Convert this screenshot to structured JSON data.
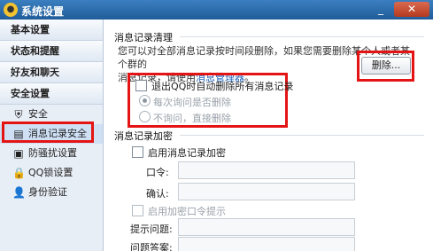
{
  "window": {
    "title": "系统设置",
    "minimize_glyph": "_",
    "close_glyph": "✕"
  },
  "sidebar": {
    "sections": [
      {
        "label": "基本设置"
      },
      {
        "label": "状态和提醒"
      },
      {
        "label": "好友和聊天"
      },
      {
        "label": "安全设置"
      }
    ],
    "items": [
      {
        "label": "安全",
        "icon": "shield-icon"
      },
      {
        "label": "消息记录安全",
        "icon": "message-record-icon"
      },
      {
        "label": "防骚扰设置",
        "icon": "anti-harass-icon"
      },
      {
        "label": "QQ锁设置",
        "icon": "lock-icon"
      },
      {
        "label": "身份验证",
        "icon": "person-icon"
      }
    ]
  },
  "main": {
    "cleanup": {
      "title": "消息记录清理",
      "desc_line1": "您可以对全部消息记录按时间段删除，如果您需要删除某个人或者某个群的",
      "desc_line2_prefix": "消息记录，请使用",
      "desc_link": "消息管理器",
      "desc_line2_suffix": "。",
      "delete_button": "删除...",
      "auto_delete_label": "退出QQ时自动删除所有消息记录",
      "radio_ask": "每次询问是否删除",
      "radio_direct": "不询问，直接删除"
    },
    "encrypt": {
      "title": "消息记录加密",
      "enable_label": "启用消息记录加密",
      "password_label": "口令:",
      "confirm_label": "确认:",
      "hint_enable_label": "启用加密口令提示",
      "question_label": "提示问题:",
      "answer_label": "问题答案:"
    }
  }
}
